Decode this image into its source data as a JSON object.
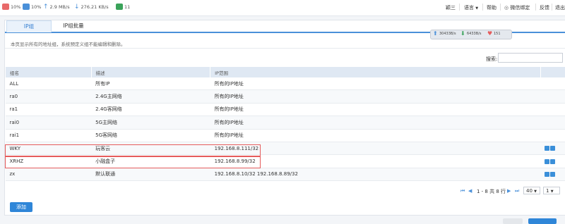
{
  "topbar": {
    "cpu": "10%",
    "mem": "10%",
    "upload": "2.9 MB/s",
    "download": "276.21 KB/s",
    "connections": "11",
    "user": "颖三",
    "language": "语言",
    "help": "帮助",
    "wechat": "微信绑定",
    "feedback": "反馈",
    "logout": "退出"
  },
  "tabs": [
    "IP组",
    "IP组批量"
  ],
  "traffic": {
    "up": "30433B/s",
    "down": "6433B/s",
    "count": "151"
  },
  "notice": "本页显示所有的地址组，系统预定义组不能编辑和删除。",
  "search": {
    "label": "搜索:",
    "value": ""
  },
  "table": {
    "headers": [
      "组名",
      "描述",
      "IP范围",
      ""
    ],
    "rows": [
      [
        "ALL",
        "所有IP",
        "所有的IP地址"
      ],
      [
        "ra0",
        "2.4G主网络",
        "所有的IP地址"
      ],
      [
        "ra1",
        "2.4G客网络",
        "所有的IP地址"
      ],
      [
        "rai0",
        "5G主网络",
        "所有的IP地址"
      ],
      [
        "rai1",
        "5G客网络",
        "所有的IP地址"
      ],
      [
        "WKY",
        "玩客云",
        "192.168.8.111/32"
      ],
      [
        "XRHZ",
        "小融盒子",
        "192.168.8.99/32"
      ],
      [
        "zx",
        "默认联通",
        "192.168.8.10/32 192.168.8.89/32"
      ]
    ]
  },
  "pager": {
    "info": "1 - 8 共 8 行",
    "page_size": "40",
    "page": "1"
  },
  "add_button": "添加"
}
